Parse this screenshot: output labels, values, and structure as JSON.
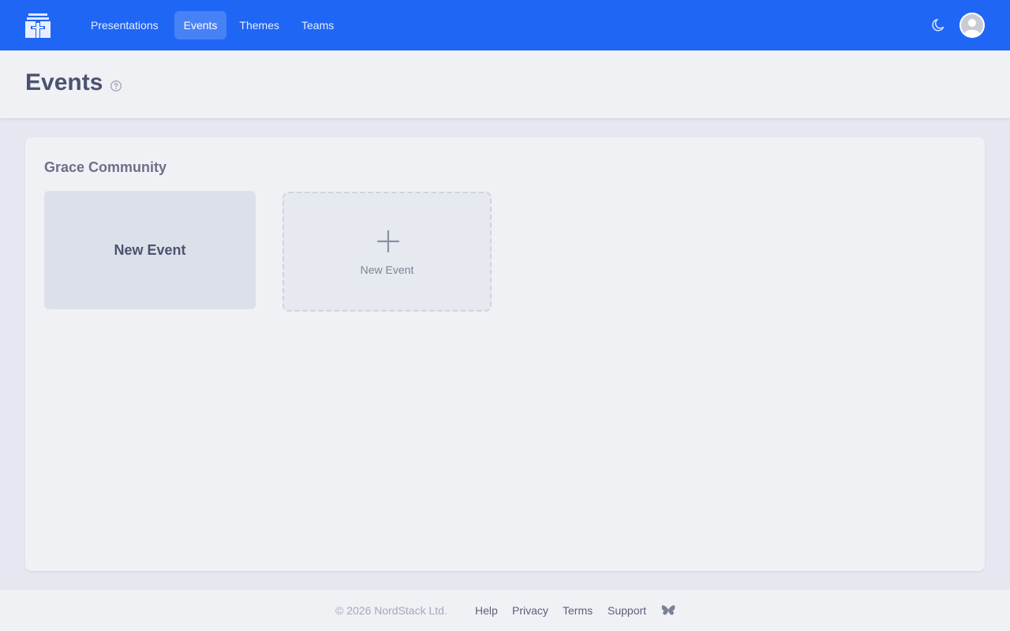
{
  "nav": {
    "items": [
      {
        "label": "Presentations",
        "active": false
      },
      {
        "label": "Events",
        "active": true
      },
      {
        "label": "Themes",
        "active": false
      },
      {
        "label": "Teams",
        "active": false
      }
    ]
  },
  "header": {
    "title": "Events"
  },
  "main": {
    "group_title": "Grace Community",
    "event_card_label": "New Event",
    "new_card_label": "New Event"
  },
  "footer": {
    "copyright": "© 2026 NordStack Ltd.",
    "links": [
      "Help",
      "Privacy",
      "Terms",
      "Support"
    ]
  },
  "icons": {
    "logo": "logo-icon",
    "theme_toggle": "moon-icon",
    "avatar": "avatar",
    "help": "help-circle-icon",
    "add": "plus-icon",
    "social": "butterfly-icon"
  },
  "colors": {
    "brand": "#1f66f5",
    "background": "#e5e8f0",
    "panel": "#eff1f5",
    "card": "#dce0e8",
    "title": "#4c5270"
  }
}
